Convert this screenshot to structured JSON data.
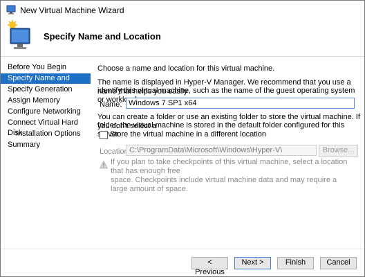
{
  "window": {
    "title": "New Virtual Machine Wizard"
  },
  "header": {
    "title": "Specify Name and Location"
  },
  "sidebar": {
    "items": [
      {
        "label": "Before You Begin",
        "active": false,
        "indent": false
      },
      {
        "label": "Specify Name and Location",
        "active": true,
        "indent": false
      },
      {
        "label": "Specify Generation",
        "active": false,
        "indent": false
      },
      {
        "label": "Assign Memory",
        "active": false,
        "indent": false
      },
      {
        "label": "Configure Networking",
        "active": false,
        "indent": false
      },
      {
        "label": "Connect Virtual Hard Disk",
        "active": false,
        "indent": false
      },
      {
        "label": "Installation Options",
        "active": false,
        "indent": true
      },
      {
        "label": "Summary",
        "active": false,
        "indent": false
      }
    ]
  },
  "main": {
    "intro": "Choose a name and location for this virtual machine.",
    "desc1_line1": "The name is displayed in Hyper-V Manager. We recommend that you use a name that helps you easily",
    "desc1_line2": "identify this virtual machine, such as the name of the guest operating system or workload.",
    "name_label": "Name:",
    "name_value": "Windows 7 SP1 x64",
    "desc2_line1": "You can create a folder or use an existing folder to store the virtual machine. If you don't select a",
    "desc2_line2": "folder, the virtual machine is stored in the default folder configured for this server.",
    "checkbox_label": "Store the virtual machine in a different location",
    "location_label": "Location:",
    "location_value": "C:\\ProgramData\\Microsoft\\Windows\\Hyper-V\\",
    "browse_label": "Browse...",
    "warning_line1": "If you plan to take checkpoints of this virtual machine, select a location that has enough free",
    "warning_line2": "space. Checkpoints include virtual machine data and may require a large amount of space."
  },
  "footer": {
    "previous": "< Previous",
    "next": "Next >",
    "finish": "Finish",
    "cancel": "Cancel"
  },
  "colors": {
    "active_item": "#1e6fc6",
    "input_border": "#5a8ed8"
  }
}
